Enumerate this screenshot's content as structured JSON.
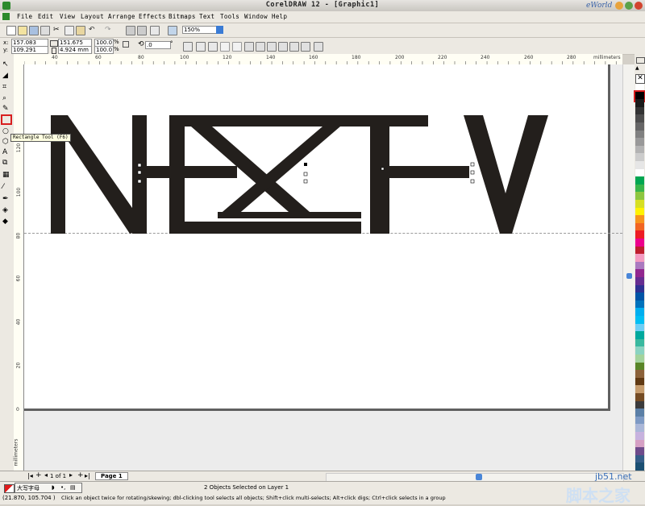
{
  "window": {
    "title": "CorelDRAW 12 - [Graphic1]"
  },
  "watermark": "eWorld",
  "menu": [
    "File",
    "Edit",
    "View",
    "Layout",
    "Arrange",
    "Effects",
    "Bitmaps",
    "Text",
    "Tools",
    "Window",
    "Help"
  ],
  "toolbar": {
    "zoom": "150%"
  },
  "property_bar": {
    "x_label": "x:",
    "x_value": "157.083 mm",
    "y_label": "y:",
    "y_value": "109.291 mm",
    "width_value": "151.675 mm",
    "height_value": "4.924 mm",
    "scale_x": "100.0",
    "scale_y": "100.0",
    "percent": "%",
    "rotation": ".0",
    "degree": "°"
  },
  "ruler": {
    "unit": "millimeters",
    "h_ticks": [
      "40",
      "60",
      "80",
      "100",
      "120",
      "140",
      "160",
      "180",
      "200",
      "220",
      "240",
      "260",
      "280"
    ],
    "v_ticks": [
      "120",
      "100",
      "80",
      "60",
      "40",
      "20",
      "0"
    ],
    "v_unit": "millimeters"
  },
  "tooltip": "Rectangle Tool (F6)",
  "artwork": {
    "text": "NEXTV",
    "fill": "#231f1c"
  },
  "page_nav": {
    "count": "1 of 1",
    "page_tab": "Page 1"
  },
  "status": {
    "selection": "2 Objects Selected on Layer 1",
    "coords": "(21.870, 105.704 )",
    "hint": "Click an object twice for rotating/skewing; dbl-clicking tool selects all objects; Shift+click multi-selects; Alt+click digs; Ctrl+click selects in a group",
    "ime": "大写字母"
  },
  "site": {
    "url": "jb51.net",
    "name": "脚本之家"
  },
  "palette_colors": [
    "#ffffff",
    "#000000",
    "#1a1a1a",
    "#333333",
    "#4d4d4d",
    "#666666",
    "#808080",
    "#999999",
    "#b3b3b3",
    "#cccccc",
    "#e6e6e6",
    "#ffffff",
    "#00a651",
    "#39b54a",
    "#8dc63f",
    "#d7df23",
    "#fff200",
    "#f7941d",
    "#f26522",
    "#ed1c24",
    "#ec008c",
    "#be1e2d",
    "#f49ac1",
    "#ab7ac0",
    "#92278f",
    "#662d91",
    "#2e3192",
    "#0054a6",
    "#0072bc",
    "#00aeef",
    "#00bff3",
    "#6dcff6",
    "#00a99d",
    "#39b99f",
    "#8ad3c1",
    "#a3d39c",
    "#598527",
    "#8c6239",
    "#603913",
    "#c69c6d",
    "#754c24",
    "#3b3b3b",
    "#5b7fa6",
    "#7e9ac4",
    "#aab7d8",
    "#c7b2de",
    "#d6a0c4",
    "#6e4b8b",
    "#355d88",
    "#1b4f72"
  ]
}
